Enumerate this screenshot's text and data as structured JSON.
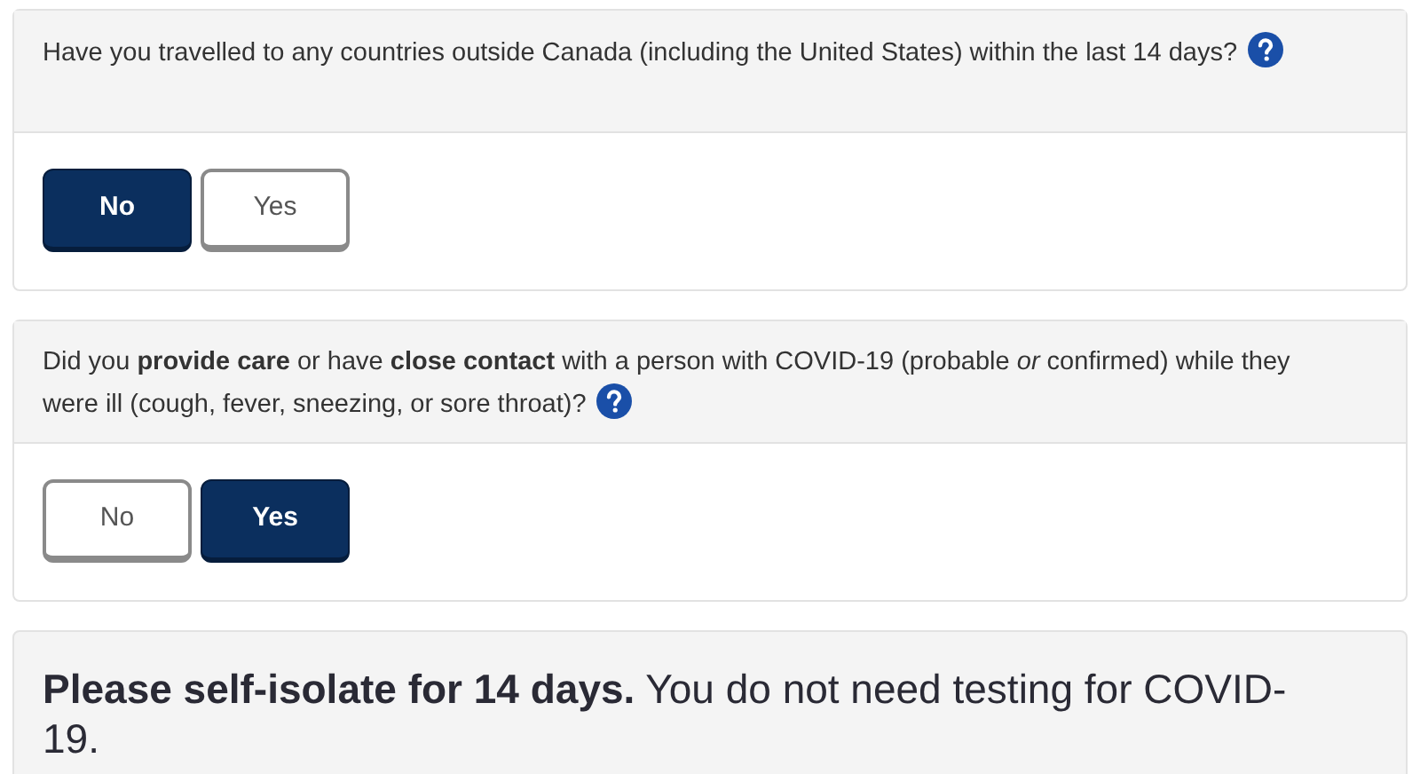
{
  "questions": [
    {
      "text": "Have you travelled to any countries outside Canada (including the United States) within the last 14 days?",
      "options": [
        {
          "label": "No",
          "selected": true
        },
        {
          "label": "Yes",
          "selected": false
        }
      ]
    },
    {
      "text": "Did you **provide care** or have **close contact** with a person with COVID-19 (probable *or* confirmed) while they were ill (cough, fever, sneezing, or sore throat)?",
      "options": [
        {
          "label": "No",
          "selected": false
        },
        {
          "label": "Yes",
          "selected": true
        }
      ]
    }
  ],
  "result": {
    "text": "**Please self-isolate for 14 days.** You do not need testing for COVID-19."
  }
}
